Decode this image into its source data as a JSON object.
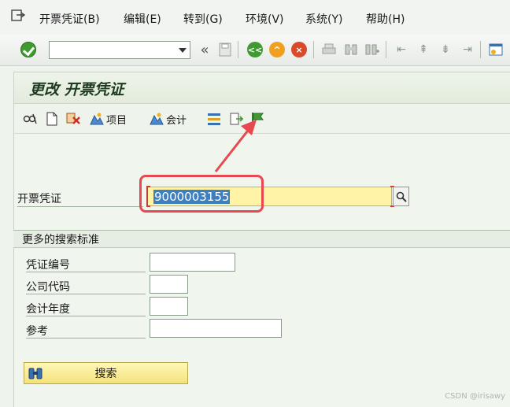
{
  "menu": {
    "items": [
      "开票凭证(B)",
      "编辑(E)",
      "转到(G)",
      "环境(V)",
      "系统(Y)",
      "帮助(H)"
    ]
  },
  "toolbar": {
    "command_value": "",
    "icons": [
      "ok-icon",
      "dropdown-icon",
      "history-back-icon",
      "save-icon",
      "back-icon",
      "exit-icon",
      "cancel-icon",
      "print-icon",
      "find-icon",
      "find-next-icon",
      "first-page-icon",
      "prev-page-icon",
      "next-page-icon",
      "last-page-icon",
      "new-session-icon"
    ]
  },
  "title": "更改 开票凭证",
  "app_toolbar": {
    "items_label": "项目",
    "accounting_label": "会计"
  },
  "main_field": {
    "label": "开票凭证",
    "value": "9000003155"
  },
  "group": {
    "title": "更多的搜索标准",
    "fields": [
      {
        "label": "凭证编号",
        "value": ""
      },
      {
        "label": "公司代码",
        "value": ""
      },
      {
        "label": "会计年度",
        "value": ""
      },
      {
        "label": "参考",
        "value": ""
      }
    ],
    "search_button": "搜索"
  },
  "watermark": "CSDN @irisawy",
  "colors": {
    "annotation": "#e8484f",
    "field_highlight": "#fff3a6",
    "selection": "#3e7fbf"
  }
}
